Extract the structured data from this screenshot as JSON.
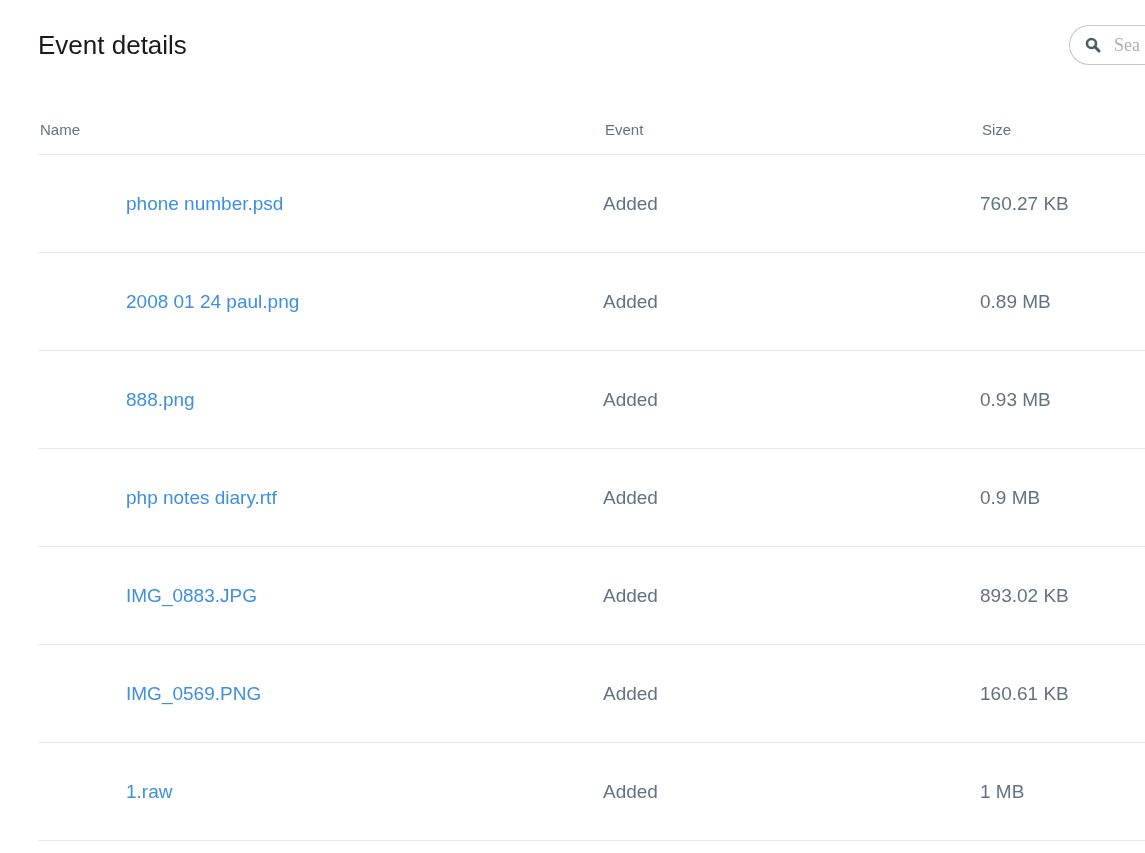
{
  "title": "Event details",
  "search": {
    "placeholder": "Sea"
  },
  "table": {
    "columns": [
      "Name",
      "Event",
      "Size"
    ],
    "rows": [
      {
        "name": "phone number.psd",
        "event": "Added",
        "size": "760.27 KB"
      },
      {
        "name": "2008 01 24 paul.png",
        "event": "Added",
        "size": "0.89 MB"
      },
      {
        "name": "888.png",
        "event": "Added",
        "size": "0.93 MB"
      },
      {
        "name": "php notes diary.rtf",
        "event": "Added",
        "size": "0.9 MB"
      },
      {
        "name": "IMG_0883.JPG",
        "event": "Added",
        "size": "893.02 KB"
      },
      {
        "name": "IMG_0569.PNG",
        "event": "Added",
        "size": "160.61 KB"
      },
      {
        "name": "1.raw",
        "event": "Added",
        "size": "1 MB"
      }
    ]
  }
}
